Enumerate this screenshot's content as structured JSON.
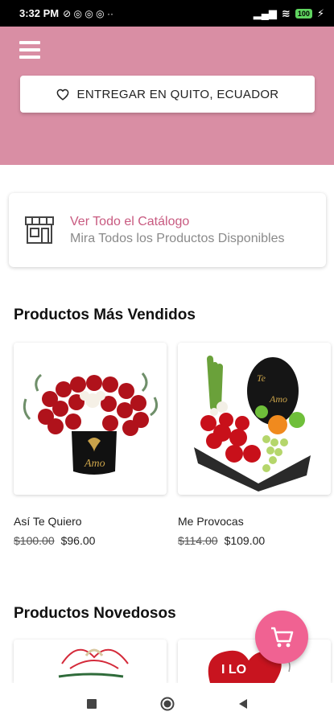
{
  "status_bar": {
    "time": "3:32 PM",
    "battery": "100"
  },
  "header": {
    "delivery_label": "ENTREGAR EN QUITO, ECUADOR"
  },
  "catalog": {
    "title": "Ver Todo el Catálogo",
    "subtitle": "Mira Todos los Productos Disponibles"
  },
  "best_sellers": {
    "title": "Productos Más Vendidos",
    "products": [
      {
        "name": "Así Te Quiero",
        "old_price": "$100.00",
        "price": "$96.00"
      },
      {
        "name": "Me Provocas",
        "old_price": "$114.00",
        "price": "$109.00"
      }
    ]
  },
  "new_products": {
    "title": "Productos Novedosos"
  },
  "colors": {
    "header_bg": "#d98ea4",
    "accent_text": "#c85a80",
    "fab": "#f06292"
  },
  "icons": [
    "menu-icon",
    "heart-icon",
    "store-icon",
    "cart-icon",
    "nav-square-icon",
    "nav-circle-icon",
    "nav-back-icon"
  ]
}
